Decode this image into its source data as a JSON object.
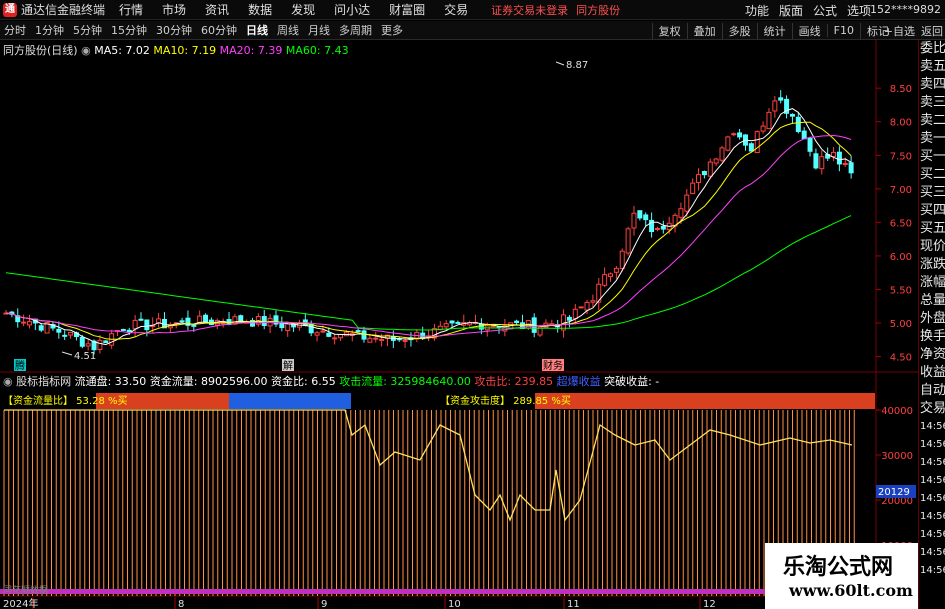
{
  "app": {
    "title": "通达信金融终端",
    "logo": "TDX"
  },
  "menu": [
    "行情",
    "市场",
    "资讯",
    "数据",
    "发现",
    "问小达",
    "财富圈",
    "交易"
  ],
  "notice": {
    "text": "证券交易未登录",
    "stock": "同方股份"
  },
  "right_menu": [
    "功能",
    "版面",
    "公式",
    "选项"
  ],
  "user": "152****9892",
  "periods": [
    "分时",
    "1分钟",
    "5分钟",
    "15分钟",
    "30分钟",
    "60分钟",
    "日线",
    "周线",
    "月线",
    "多周期",
    "更多"
  ],
  "active_period": "日线",
  "tools": [
    "复权",
    "叠加",
    "多股",
    "统计",
    "画线",
    "F10",
    "标记"
  ],
  "tools2": [
    "+自选",
    "返回"
  ],
  "main_info": {
    "stock": "同方股份(日线)",
    "ma5": "MA5: 7.02",
    "ma10": "MA10: 7.19",
    "ma20": "MA20: 7.39",
    "ma60": "MA60: 7.43"
  },
  "price_axis": [
    "8.50",
    "8.00",
    "7.50",
    "7.00",
    "6.50",
    "6.00",
    "5.50",
    "5.00",
    "4.50"
  ],
  "annotations": {
    "high": "8.87",
    "low": "4.51",
    "m1": "腾",
    "m2": "解",
    "m3": "财务"
  },
  "indicator_info": {
    "name": "股标指标网",
    "float": "流通盘: 33.50",
    "flow": "资金流量: 8902596.00",
    "ratio": "资金比: 6.55",
    "attack": "攻击流量: 325984640.00",
    "attack_ratio": "攻击比: 239.85",
    "extra": "超爆收益",
    "breakout": "突破收益: -"
  },
  "ind_label1": "【资金流量比】 53.28 %买",
  "ind_label2": "【资金攻击度】 289.85 %买",
  "ind_axis": [
    "40000",
    "30000",
    "20000",
    "10000"
  ],
  "ind_current": "20129",
  "date_axis": [
    "2024年",
    "8",
    "9",
    "10",
    "11",
    "12"
  ],
  "bottom_label": "同花顺数据",
  "right_panel": [
    "委比",
    "卖五",
    "卖四",
    "卖三",
    "卖二",
    "卖一",
    "买一",
    "买二",
    "买三",
    "买四",
    "买五",
    "现价",
    "涨跌",
    "涨幅",
    "总量",
    "外盘",
    "换手",
    "净资",
    "收益",
    "自动",
    "交易",
    "14:56",
    "14:56",
    "14:56",
    "14:56",
    "14:56",
    "14:56",
    "14:56",
    "14:56",
    "14:56"
  ],
  "watermark": {
    "line1": "乐淘公式网",
    "line2": "www.60lt.com"
  },
  "colors": {
    "up": "#ff4040",
    "down": "#54ffff",
    "ma5": "#ffffff",
    "ma10": "#ffff00",
    "ma20": "#ff40ff",
    "ma60": "#00ff00",
    "bar": "#ff9040"
  }
}
